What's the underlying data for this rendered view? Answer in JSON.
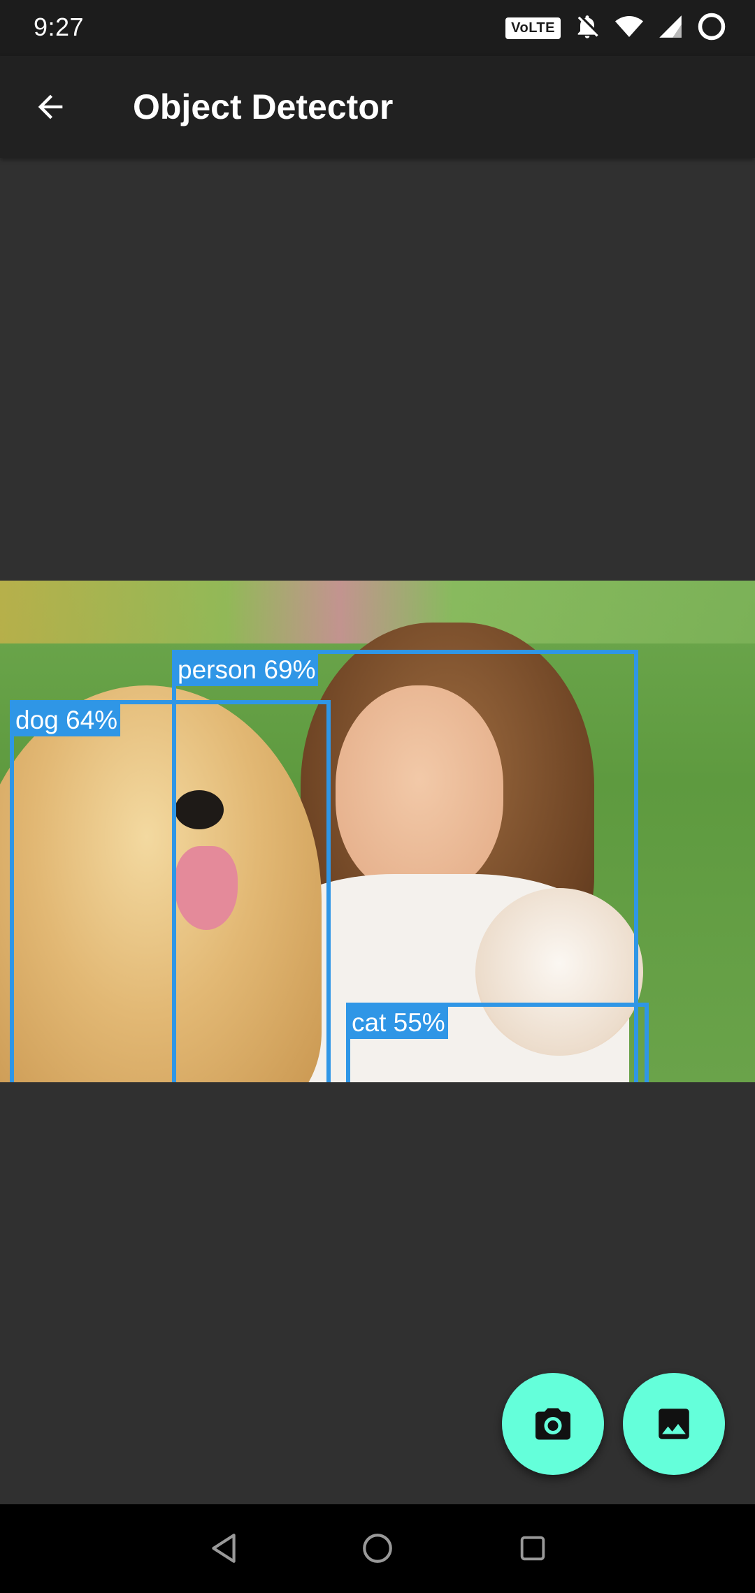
{
  "status_bar": {
    "time": "9:27",
    "volte": "VoLTE",
    "icons": [
      "volte-icon",
      "notifications-off-icon",
      "wifi-icon",
      "cell-signal-icon",
      "battery-saver-icon"
    ]
  },
  "app_bar": {
    "back_icon": "arrow-back-icon",
    "title": "Object Detector"
  },
  "detections": [
    {
      "label": "person 69%",
      "color": "#2f96e6"
    },
    {
      "label": "dog 64%",
      "color": "#2f96e6"
    },
    {
      "label": "cat 55%",
      "color": "#2f96e6"
    }
  ],
  "fabs": [
    {
      "icon": "camera-icon",
      "color": "#64ffda"
    },
    {
      "icon": "image-icon",
      "color": "#64ffda"
    }
  ],
  "nav_bar": {
    "icons": [
      "nav-back-icon",
      "nav-home-icon",
      "nav-recents-icon"
    ]
  },
  "colors": {
    "status_bar_bg": "#1c1c1c",
    "app_bar_bg": "#212121",
    "content_bg": "#303030",
    "box_color": "#2f96e6",
    "fab_color": "#64ffda"
  }
}
